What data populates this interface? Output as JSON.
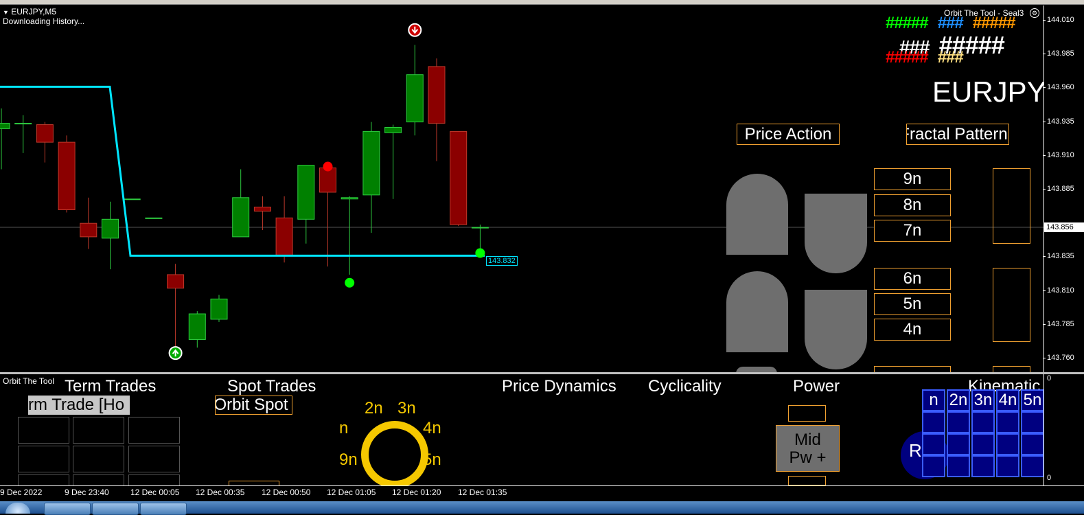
{
  "chart": {
    "symbol_title": "EURJPY,M5",
    "status": "Downloading History...",
    "indicator_name": "Orbit The Tool - Seal3",
    "big_symbol": "EURJPY",
    "line_price_label": "143.832",
    "current_price": "143.856",
    "price_ticks": [
      "144.010",
      "143.985",
      "143.960",
      "143.935",
      "143.910",
      "143.885",
      "143.835",
      "143.810",
      "143.785",
      "143.760"
    ],
    "hash_rows": [
      [
        {
          "text": "#####",
          "color": "#00ff00"
        },
        {
          "text": "###",
          "color": "#1e90ff"
        },
        {
          "text": "#####",
          "color": "#ff9900"
        }
      ],
      [
        {
          "text": "###",
          "color": "#ffffff"
        },
        {
          "text": "#####",
          "color": "#ffffff"
        }
      ],
      [
        {
          "text": "#####",
          "color": "#ff0000"
        },
        {
          "text": "###",
          "color": "#ffe080"
        }
      ]
    ],
    "buttons": {
      "price_action": "Price Action",
      "fractal_pattern": "Fractal Pattern"
    },
    "levels_top": [
      "9n",
      "8n",
      "7n"
    ],
    "levels_bottom": [
      "6n",
      "5n",
      "4n"
    ]
  },
  "indicator": {
    "name": "Orbit The Tool",
    "term_trades": "Term Trades",
    "term_trade_field": "rm Trade [Ho",
    "spot_trades": "Spot Trades",
    "spot_field": "Orbit Spot",
    "price_dynamics": "Price Dynamics",
    "cyclicality": "Cyclicality",
    "power": "Power",
    "kinematics": "Kinematic",
    "power_box": {
      "line1": "Mid",
      "line2": "Pw +"
    },
    "cycle_labels": [
      "2n",
      "3n",
      "n",
      "4n",
      "9n",
      "5n"
    ],
    "kin_headers": [
      "n",
      "2n",
      "3n",
      "4n",
      "5n"
    ],
    "r_label": "R",
    "axis_top": "0",
    "axis_bottom": "0"
  },
  "time_axis": [
    "9 Dec 2022",
    "9 Dec 23:40",
    "12 Dec 00:05",
    "12 Dec 00:35",
    "12 Dec 00:50",
    "12 Dec 01:05",
    "12 Dec 01:20",
    "12 Dec 01:35"
  ],
  "colors": {
    "up": "#008000",
    "down": "#8b0000",
    "cyan_line": "#00e5ff",
    "orange_border": "#f0a030",
    "gold": "#f5c800",
    "navy": "#000080"
  },
  "candles": [
    {
      "o": 143.93,
      "h": 143.945,
      "l": 143.9,
      "c": 143.934
    },
    {
      "o": 143.934,
      "h": 143.94,
      "l": 143.912,
      "c": 143.934
    },
    {
      "o": 143.933,
      "h": 143.935,
      "l": 143.905,
      "c": 143.92
    },
    {
      "o": 143.92,
      "h": 143.925,
      "l": 143.868,
      "c": 143.87
    },
    {
      "o": 143.86,
      "h": 143.879,
      "l": 143.841,
      "c": 143.85
    },
    {
      "o": 143.849,
      "h": 143.876,
      "l": 143.826,
      "c": 143.863
    },
    {
      "o": 143.878,
      "h": 143.878,
      "l": 143.878,
      "c": 143.878
    },
    {
      "o": 143.864,
      "h": 143.864,
      "l": 143.864,
      "c": 143.864
    },
    {
      "o": 143.822,
      "h": 143.83,
      "l": 143.766,
      "c": 143.812
    },
    {
      "o": 143.774,
      "h": 143.795,
      "l": 143.768,
      "c": 143.793
    },
    {
      "o": 143.789,
      "h": 143.807,
      "l": 143.787,
      "c": 143.804
    },
    {
      "o": 143.85,
      "h": 143.9,
      "l": 143.85,
      "c": 143.879
    },
    {
      "o": 143.872,
      "h": 143.88,
      "l": 143.855,
      "c": 143.869
    },
    {
      "o": 143.864,
      "h": 143.88,
      "l": 143.831,
      "c": 143.836
    },
    {
      "o": 143.863,
      "h": 143.903,
      "l": 143.845,
      "c": 143.903
    },
    {
      "o": 143.901,
      "h": 143.901,
      "l": 143.828,
      "c": 143.883
    },
    {
      "o": 143.878,
      "h": 143.88,
      "l": 143.822,
      "c": 143.879
    },
    {
      "o": 143.881,
      "h": 143.935,
      "l": 143.853,
      "c": 143.928
    },
    {
      "o": 143.927,
      "h": 143.933,
      "l": 143.878,
      "c": 143.931
    },
    {
      "o": 143.935,
      "h": 143.992,
      "l": 143.925,
      "c": 143.97
    },
    {
      "o": 143.976,
      "h": 143.982,
      "l": 143.906,
      "c": 143.934
    },
    {
      "o": 143.928,
      "h": 143.928,
      "l": 143.858,
      "c": 143.859
    },
    {
      "o": 143.857,
      "h": 143.859,
      "l": 143.837,
      "c": 143.857
    }
  ],
  "signals": [
    {
      "i": 8,
      "price": 143.764,
      "type": "up-arrow"
    },
    {
      "i": 15,
      "price": 143.902,
      "type": "red-dot"
    },
    {
      "i": 16,
      "price": 143.816,
      "type": "green-dot"
    },
    {
      "i": 19,
      "price": 144.003,
      "type": "down-arrow"
    },
    {
      "i": 22,
      "price": 143.838,
      "type": "green-dot"
    }
  ],
  "cyan_line": [
    [
      143.961,
      0
    ],
    [
      143.961,
      160
    ],
    [
      143.836,
      190
    ],
    [
      143.836,
      706
    ]
  ]
}
